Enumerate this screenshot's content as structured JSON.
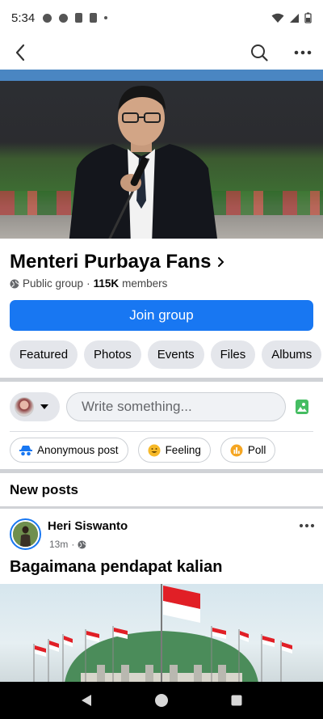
{
  "status_bar": {
    "time": "5:34"
  },
  "group": {
    "name": "Menteri Purbaya Fans",
    "privacy": "Public group",
    "separator": "·",
    "members_count": "115K",
    "members_label": "members"
  },
  "join_button": {
    "label": "Join group"
  },
  "tabs": [
    {
      "label": "Featured"
    },
    {
      "label": "Photos"
    },
    {
      "label": "Events"
    },
    {
      "label": "Files"
    },
    {
      "label": "Albums"
    }
  ],
  "composer": {
    "placeholder": "Write something..."
  },
  "post_actions": [
    {
      "label": "Anonymous post",
      "icon": "anonymous-icon"
    },
    {
      "label": "Feeling",
      "icon": "feeling-icon"
    },
    {
      "label": "Poll",
      "icon": "poll-icon"
    }
  ],
  "feed": {
    "section_title": "New posts",
    "post": {
      "author": "Heri Siswanto",
      "time": "13m",
      "separator": "·",
      "heading": "Bagaimana pendapat kalian"
    }
  },
  "colors": {
    "primary": "#1877f2",
    "chip_bg": "#e4e6eb",
    "flag_red": "#e11f26",
    "dome_green": "#4b8c5a"
  }
}
